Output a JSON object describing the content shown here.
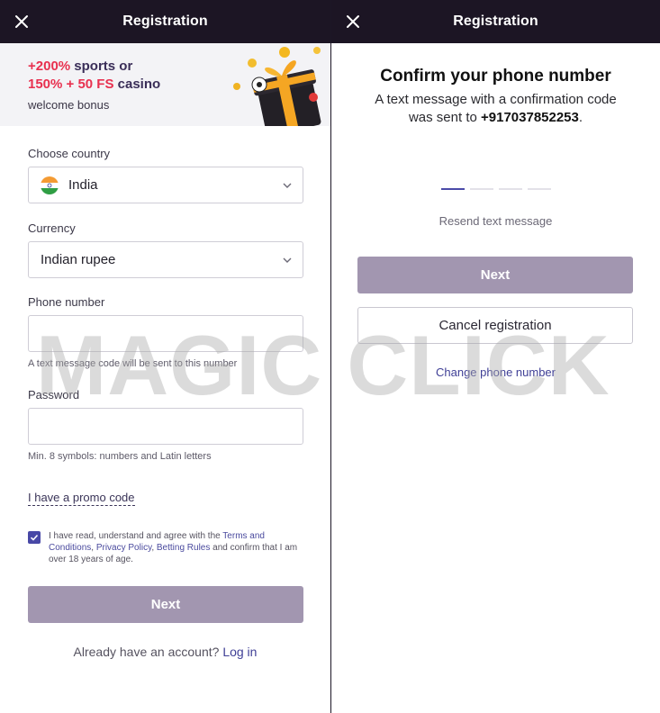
{
  "left": {
    "header": {
      "title": "Registration",
      "close_icon": "close-icon"
    },
    "banner": {
      "line1_highlight": "+200%",
      "line1_rest": " sports or",
      "line2_highlight": "150% + 50 FS",
      "line2_rest": " casino",
      "line3": "welcome bonus",
      "image_icon": "gift-box-icon"
    },
    "country": {
      "label": "Choose country",
      "value": "India",
      "flag_icon": "india-flag-icon"
    },
    "currency": {
      "label": "Currency",
      "value": "Indian rupee"
    },
    "phone": {
      "label": "Phone number",
      "value": "",
      "hint": "A text message code will be sent to this number"
    },
    "password": {
      "label": "Password",
      "value": "",
      "hint": "Min. 8 symbols: numbers and Latin letters"
    },
    "promo_label": "I have a promo code",
    "agreement": {
      "checked": true,
      "text1": "I have read, understand and agree with the ",
      "link_terms": "Terms and Conditions",
      "sep1": ", ",
      "link_privacy": "Privacy Policy",
      "sep2": ", ",
      "link_betting": "Betting Rules",
      "text2": " and confirm that I am over 18 years of age."
    },
    "next_label": "Next",
    "login_prompt": "Already have an account?",
    "login_link": "Log in"
  },
  "right": {
    "header": {
      "title": "Registration",
      "close_icon": "close-icon"
    },
    "confirm_title": "Confirm your phone number",
    "desc_line1": "A text message with a confirmation code",
    "desc_line2_prefix": "was sent to ",
    "phone_number": "+917037852253",
    "desc_line2_suffix": ".",
    "code_slots_total": 4,
    "code_slots_active": 1,
    "resend_label": "Resend text message",
    "next_label": "Next",
    "cancel_label": "Cancel registration",
    "change_phone_label": "Change phone number"
  },
  "watermark": "MAGIC CLICK",
  "colors": {
    "header_bg": "#1c1524",
    "accent": "#4848a6",
    "button_disabled": "#a296b0",
    "bonus_highlight": "#e8304f"
  }
}
